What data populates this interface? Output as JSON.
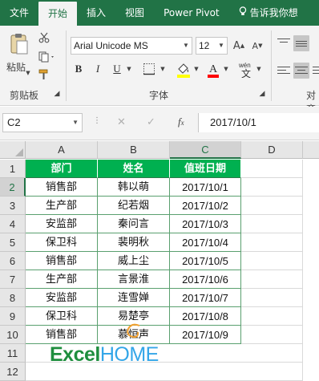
{
  "ribbon_tabs": [
    "文件",
    "开始",
    "插入",
    "视图",
    "Power Pivot",
    "告诉我你想"
  ],
  "ribbon": {
    "clipboard": {
      "paste_label": "粘贴",
      "group_label": "剪贴板"
    },
    "font": {
      "font_name": "Arial Unicode MS",
      "font_size": "12",
      "group_label": "字体",
      "bold": "B",
      "italic": "I",
      "underline": "U"
    },
    "alignment": {
      "group_label": "对齐"
    }
  },
  "formula_bar": {
    "name_box": "C2",
    "formula": "2017/10/1"
  },
  "columns": [
    "A",
    "B",
    "C",
    "D"
  ],
  "rows": [
    "1",
    "2",
    "3",
    "4",
    "5",
    "6",
    "7",
    "8",
    "9",
    "10",
    "11",
    "12"
  ],
  "table": {
    "headers": [
      "部门",
      "姓名",
      "值班日期"
    ],
    "rows": [
      [
        "销售部",
        "韩以萌",
        "2017/10/1"
      ],
      [
        "生产部",
        "纪若烟",
        "2017/10/2"
      ],
      [
        "安监部",
        "秦问言",
        "2017/10/3"
      ],
      [
        "保卫科",
        "裴明秋",
        "2017/10/4"
      ],
      [
        "销售部",
        "威上尘",
        "2017/10/5"
      ],
      [
        "生产部",
        "言景淮",
        "2017/10/6"
      ],
      [
        "安监部",
        "连雪婵",
        "2017/10/7"
      ],
      [
        "保卫科",
        "易楚亭",
        "2017/10/8"
      ],
      [
        "销售部",
        "慕恒声",
        "2017/10/9"
      ]
    ]
  },
  "watermark": {
    "brand_a": "Excel",
    "brand_b": "HOME"
  },
  "colors": {
    "ribbon_green": "#217346",
    "header_fill": "#00b050"
  }
}
